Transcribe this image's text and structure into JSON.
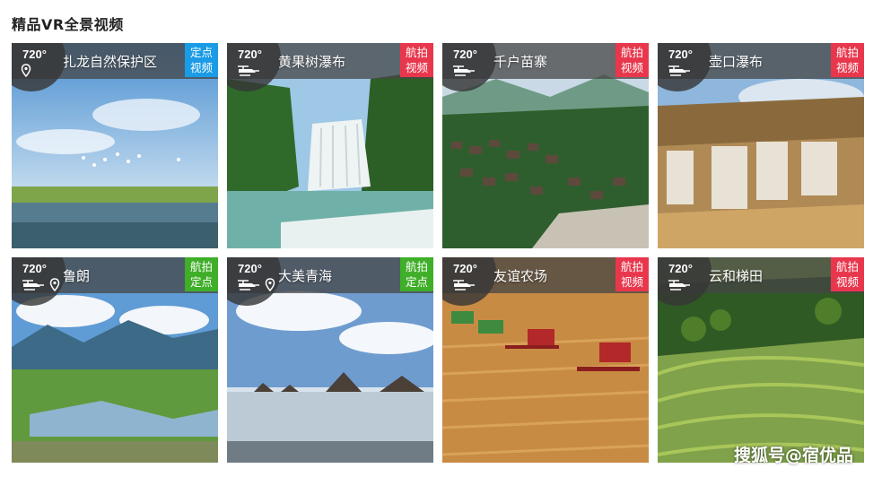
{
  "section": {
    "title": "精品VR全景视频"
  },
  "colors": {
    "blue_badge": "#1a9be6",
    "red_badge": "#e8374c",
    "green_badge": "#3fae29"
  },
  "cards": [
    {
      "deg": "720°",
      "title": "扎龙自然保护区",
      "badge_top": "定点",
      "badge_bottom": "视频",
      "badge_color": "#1a9be6",
      "icons": [
        "location-pin-icon"
      ],
      "scene": "wetland-cranes"
    },
    {
      "deg": "720°",
      "title": "黄果树瀑布",
      "badge_top": "航拍",
      "badge_bottom": "视频",
      "badge_color": "#e8374c",
      "icons": [
        "drone-icon"
      ],
      "scene": "waterfall"
    },
    {
      "deg": "720°",
      "title": "千户苗寨",
      "badge_top": "航拍",
      "badge_bottom": "视频",
      "badge_color": "#e8374c",
      "icons": [
        "drone-icon"
      ],
      "scene": "village"
    },
    {
      "deg": "720°",
      "title": "壶口瀑布",
      "badge_top": "航拍",
      "badge_bottom": "视频",
      "badge_color": "#e8374c",
      "icons": [
        "drone-icon"
      ],
      "scene": "yellow-falls"
    },
    {
      "deg": "720°",
      "title": "鲁朗",
      "badge_top": "航拍",
      "badge_bottom": "定点",
      "badge_color": "#3fae29",
      "icons": [
        "drone-icon",
        "location-pin-icon"
      ],
      "scene": "valley"
    },
    {
      "deg": "720°",
      "title": "大美青海",
      "badge_top": "航拍",
      "badge_bottom": "定点",
      "badge_color": "#3fae29",
      "icons": [
        "drone-icon",
        "location-pin-icon"
      ],
      "scene": "salt-lake"
    },
    {
      "deg": "720°",
      "title": "友谊农场",
      "badge_top": "航拍",
      "badge_bottom": "视频",
      "badge_color": "#e8374c",
      "icons": [
        "drone-icon"
      ],
      "scene": "harvest"
    },
    {
      "deg": "720°",
      "title": "云和梯田",
      "badge_top": "航拍",
      "badge_bottom": "视频",
      "badge_color": "#e8374c",
      "icons": [
        "drone-icon"
      ],
      "scene": "terraces"
    }
  ],
  "watermark": "搜狐号@宿优品"
}
